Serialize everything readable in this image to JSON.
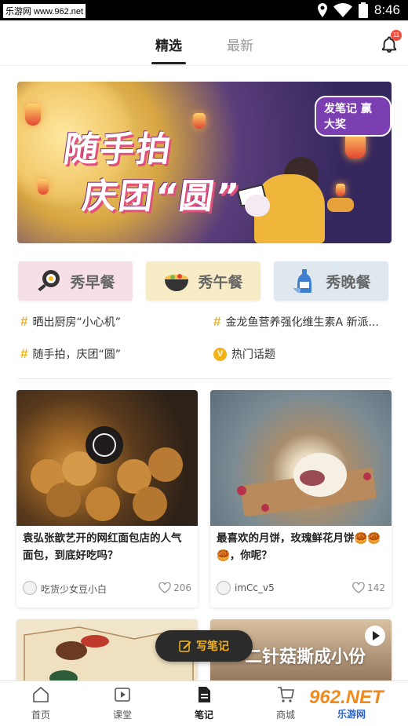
{
  "status_bar": {
    "watermark": "乐游网 www.962.net",
    "time": "8:46"
  },
  "tabs": [
    {
      "label": "精选",
      "active": true
    },
    {
      "label": "最新",
      "active": false
    }
  ],
  "notification": {
    "badge": "11"
  },
  "banner": {
    "badge": "发笔记 赢大奖",
    "title_line1": "随手拍",
    "title_line2": "庆团“圆”"
  },
  "categories": [
    {
      "label": "秀早餐"
    },
    {
      "label": "秀午餐"
    },
    {
      "label": "秀晚餐"
    }
  ],
  "topics": [
    {
      "label": "晒出厨房“小心机”",
      "icon": "hash-icon"
    },
    {
      "label": "金龙鱼营养强化维生素A 新派...",
      "icon": "hash-icon"
    },
    {
      "label": "随手拍，庆团“圆”",
      "icon": "hash-icon"
    },
    {
      "label": "热门话题",
      "icon": "v-badge-icon"
    }
  ],
  "hash_symbol": "#",
  "feed": [
    {
      "title": "袁弘张歆艺开的网红面包店的人气面包，到底好吃吗？",
      "user": "吃货少女豆小白",
      "likes": "206"
    },
    {
      "title": "最喜欢的月饼，玫瑰鲜花月饼🥮🥮🥮，你呢？",
      "user": "imCc_v5",
      "likes": "142"
    }
  ],
  "partial_card": {
    "overlay_text": "二针菇撕成小份"
  },
  "fab": {
    "label": "写笔记"
  },
  "bottom_nav": [
    {
      "label": "首页",
      "icon": "home-icon",
      "active": false
    },
    {
      "label": "课堂",
      "icon": "play-icon",
      "active": false
    },
    {
      "label": "笔记",
      "icon": "note-icon",
      "active": true
    },
    {
      "label": "商城",
      "icon": "cart-icon",
      "active": false
    }
  ],
  "corner_watermark": {
    "line1": "962.NET",
    "line2": "乐游网"
  },
  "colors": {
    "accent": "#f3b21b",
    "badge_red": "#f04b3b",
    "dark": "#222222"
  }
}
